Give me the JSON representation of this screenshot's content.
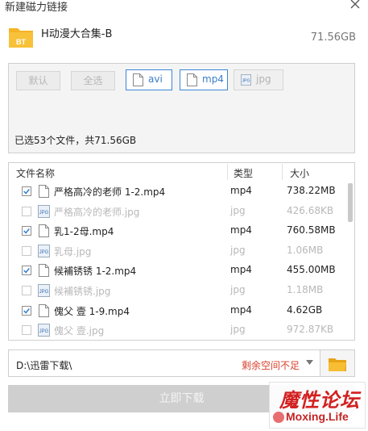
{
  "window": {
    "title": "新建磁力链接"
  },
  "torrent": {
    "name": "H动漫大合集-B",
    "size": "71.56GB",
    "folder_badge": "BT"
  },
  "filters": {
    "default_label": "默认",
    "select_all_label": "全选",
    "chips": [
      {
        "label": "avi",
        "enabled": true
      },
      {
        "label": "mp4",
        "enabled": true
      },
      {
        "label": "jpg",
        "enabled": false
      }
    ],
    "summary": "已选53个文件，共71.56GB"
  },
  "table": {
    "columns": [
      "文件名称",
      "类型",
      "大小"
    ],
    "rows": [
      {
        "name": "严格高冷的老师 1-2.mp4",
        "type": "mp4",
        "size": "738.22MB",
        "checked": true
      },
      {
        "name": "严格高冷的老师.jpg",
        "type": "jpg",
        "size": "426.68KB",
        "checked": false
      },
      {
        "name": "乳1-2母.mp4",
        "type": "mp4",
        "size": "760.58MB",
        "checked": true
      },
      {
        "name": "乳母.jpg",
        "type": "jpg",
        "size": "1.06MB",
        "checked": false
      },
      {
        "name": "候補锈锈 1-2.mp4",
        "type": "mp4",
        "size": "455.00MB",
        "checked": true
      },
      {
        "name": "候補锈锈.jpg",
        "type": "jpg",
        "size": "1.18MB",
        "checked": false
      },
      {
        "name": "傀父 壹 1-9.mp4",
        "type": "mp4",
        "size": "4.62GB",
        "checked": true
      },
      {
        "name": "傀父 壹.jpg",
        "type": "jpg",
        "size": "972.87KB",
        "checked": false
      }
    ]
  },
  "download": {
    "path": "D:\\迅雷下载\\",
    "space_warning": "剩余空间不足",
    "button_label": "立即下载"
  },
  "watermark": {
    "cn": "魔性论坛",
    "en": "Moxing.Life"
  },
  "colors": {
    "accent": "#3a86d7",
    "warning": "#d9432f",
    "folder": "#f5b325",
    "check": "#2f7fd1"
  }
}
